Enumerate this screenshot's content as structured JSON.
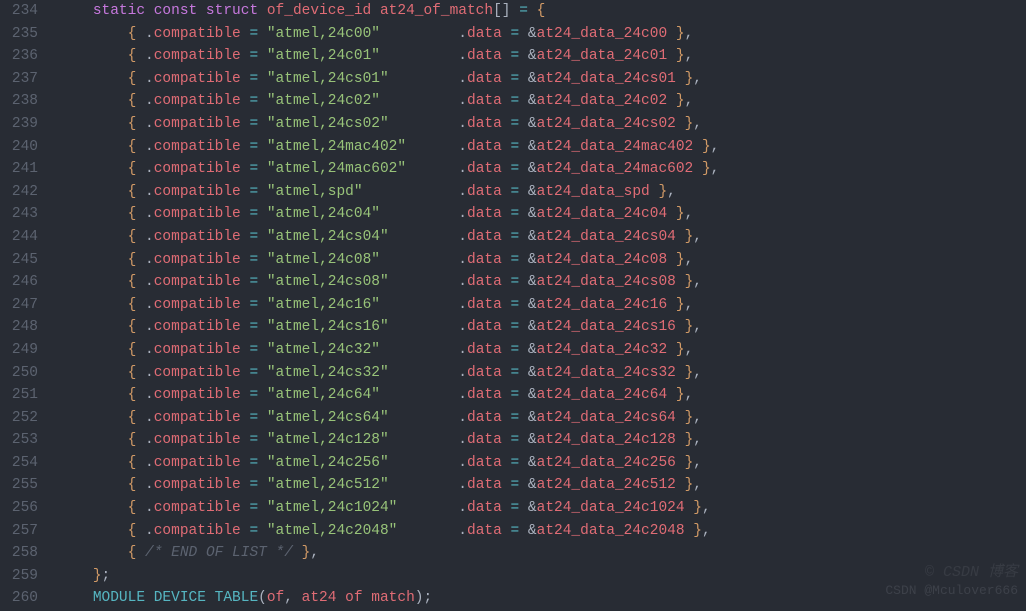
{
  "editor": {
    "first_line_number": 234,
    "lines": [
      {
        "entry": null,
        "modifiers": "static const struct",
        "type": "of_device_id",
        "name": "at24_of_match",
        "array": true,
        "open": true
      },
      {
        "entry": {
          "compat": "atmel,24c00",
          "data": "at24_data_24c00"
        }
      },
      {
        "entry": {
          "compat": "atmel,24c01",
          "data": "at24_data_24c01"
        }
      },
      {
        "entry": {
          "compat": "atmel,24cs01",
          "data": "at24_data_24cs01"
        }
      },
      {
        "entry": {
          "compat": "atmel,24c02",
          "data": "at24_data_24c02"
        }
      },
      {
        "entry": {
          "compat": "atmel,24cs02",
          "data": "at24_data_24cs02"
        }
      },
      {
        "entry": {
          "compat": "atmel,24mac402",
          "data": "at24_data_24mac402"
        }
      },
      {
        "entry": {
          "compat": "atmel,24mac602",
          "data": "at24_data_24mac602"
        }
      },
      {
        "entry": {
          "compat": "atmel,spd",
          "data": "at24_data_spd"
        }
      },
      {
        "entry": {
          "compat": "atmel,24c04",
          "data": "at24_data_24c04"
        }
      },
      {
        "entry": {
          "compat": "atmel,24cs04",
          "data": "at24_data_24cs04"
        }
      },
      {
        "entry": {
          "compat": "atmel,24c08",
          "data": "at24_data_24c08"
        }
      },
      {
        "entry": {
          "compat": "atmel,24cs08",
          "data": "at24_data_24cs08"
        }
      },
      {
        "entry": {
          "compat": "atmel,24c16",
          "data": "at24_data_24c16"
        }
      },
      {
        "entry": {
          "compat": "atmel,24cs16",
          "data": "at24_data_24cs16"
        }
      },
      {
        "entry": {
          "compat": "atmel,24c32",
          "data": "at24_data_24c32"
        }
      },
      {
        "entry": {
          "compat": "atmel,24cs32",
          "data": "at24_data_24cs32"
        }
      },
      {
        "entry": {
          "compat": "atmel,24c64",
          "data": "at24_data_24c64"
        }
      },
      {
        "entry": {
          "compat": "atmel,24cs64",
          "data": "at24_data_24cs64"
        }
      },
      {
        "entry": {
          "compat": "atmel,24c128",
          "data": "at24_data_24c128"
        }
      },
      {
        "entry": {
          "compat": "atmel,24c256",
          "data": "at24_data_24c256"
        }
      },
      {
        "entry": {
          "compat": "atmel,24c512",
          "data": "at24_data_24c512"
        }
      },
      {
        "entry": {
          "compat": "atmel,24c1024",
          "data": "at24_data_24c1024"
        }
      },
      {
        "entry": {
          "compat": "atmel,24c2048",
          "data": "at24_data_24c2048"
        }
      },
      {
        "end_comment": "/* END OF LIST */"
      },
      {
        "close": "};"
      },
      {
        "module_line": {
          "macro": "MODULE_DEVICE_TABLE",
          "arg1": "of",
          "arg2": "at24_of_match"
        }
      }
    ],
    "string_col_width": 17,
    "indent": "    ",
    "entry_indent": "        "
  },
  "watermark1": "© CSDN 博客",
  "watermark2": "CSDN @Mculover666"
}
